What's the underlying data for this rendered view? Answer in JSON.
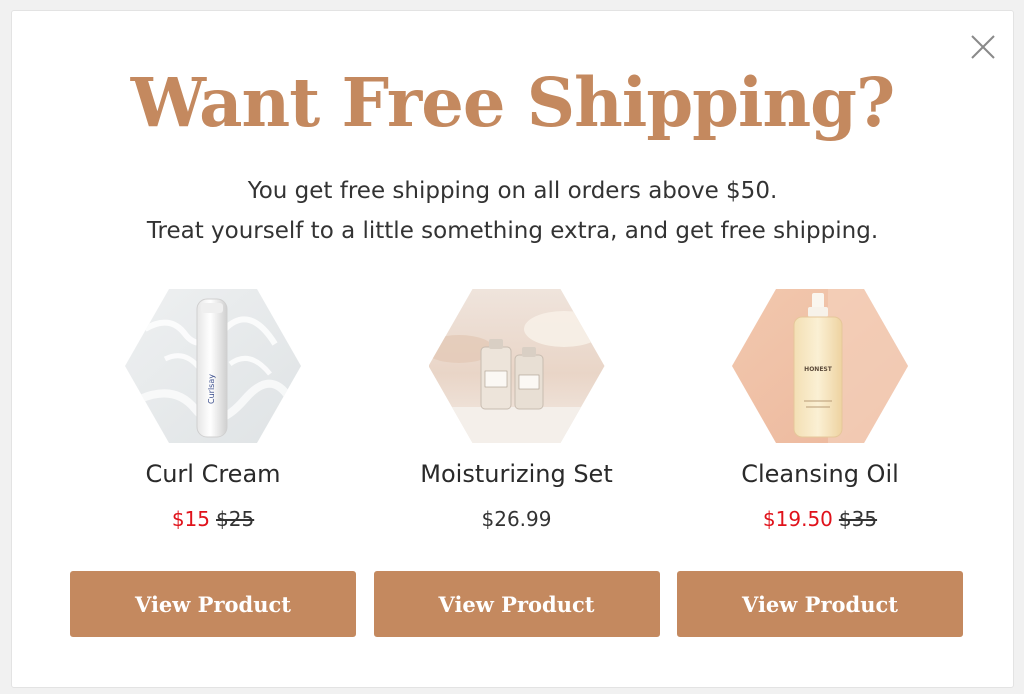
{
  "popup": {
    "title": "Want Free Shipping?",
    "subtitle_line1": "You get free shipping on all orders above $50.",
    "subtitle_line2": "Treat yourself to a little something extra, and get free shipping.",
    "close_icon": "close-icon"
  },
  "colors": {
    "accent": "#c4895f",
    "sale_price": "#e0121b",
    "button_text": "#ffffff"
  },
  "products": [
    {
      "name": "Curl Cream",
      "sale_price": "$15",
      "original_price": "$25",
      "button_label": "View Product",
      "image": "curl-cream-bottle-image",
      "bottle_label": "Curlsay"
    },
    {
      "name": "Moisturizing Set",
      "price": "$26.99",
      "button_label": "View Product",
      "image": "moisturizing-set-image"
    },
    {
      "name": "Cleansing Oil",
      "sale_price": "$19.50",
      "original_price": "$35",
      "button_label": "View Product",
      "image": "cleansing-oil-bottle-image",
      "bottle_label": "HONEST"
    }
  ]
}
